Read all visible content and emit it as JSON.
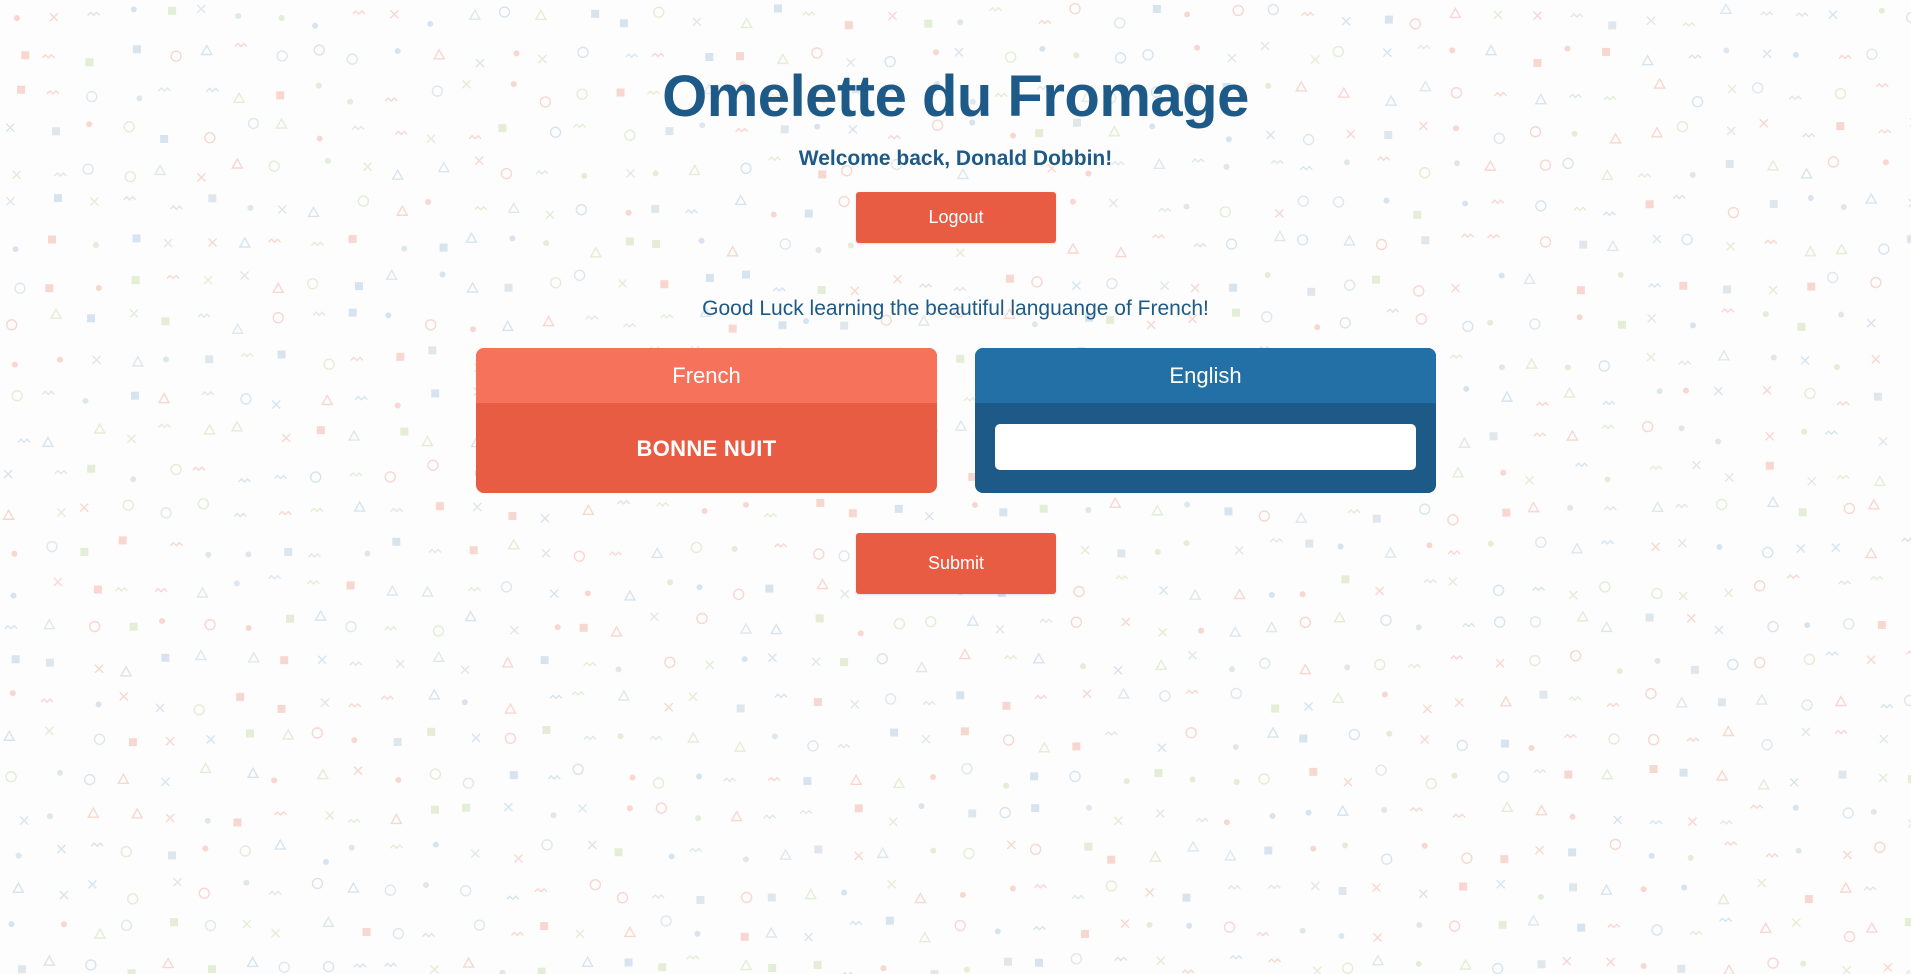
{
  "app": {
    "title": "Omelette du Fromage"
  },
  "header": {
    "welcome_text": "Welcome back, Donald Dobbin!",
    "logout_label": "Logout"
  },
  "main": {
    "tagline": "Good Luck learning the beautiful languange of French!",
    "french_card": {
      "header": "French",
      "word": "BONNE NUIT"
    },
    "english_card": {
      "header": "English",
      "input_value": "",
      "input_placeholder": ""
    },
    "submit_label": "Submit"
  },
  "colors": {
    "title_blue": "#1d5a87",
    "accent_coral": "#e95c44",
    "coral_light": "#f7725b",
    "blue_light": "#2270a6",
    "pattern_colors": [
      "#f4b8ab",
      "#b8cfe3",
      "#cfe0b5",
      "#c9d5de"
    ]
  }
}
